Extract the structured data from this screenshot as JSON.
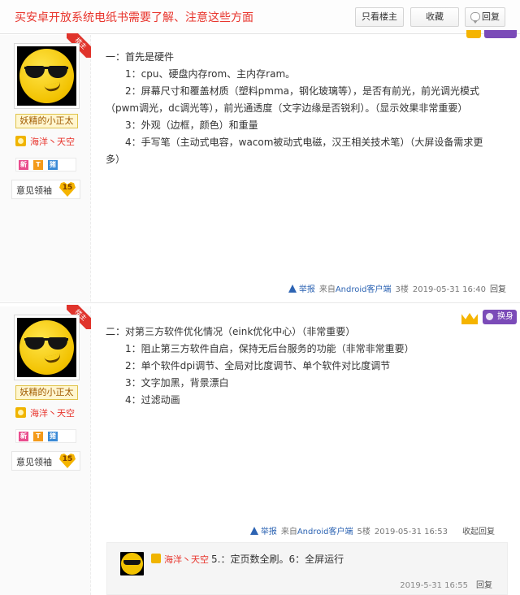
{
  "header": {
    "title": "买安卓开放系统电纸书需要了解、注意这些方面",
    "only_owner": "只看楼主",
    "favorite": "收藏",
    "reply": "回复"
  },
  "posts": [
    {
      "username": "妖精的小正太",
      "group": "海洋丶天空",
      "owner_tag": "楼主",
      "badges": [
        "新",
        "T",
        "猪"
      ],
      "level_label": "意见领袖",
      "level": "15",
      "lines": [
        "一：首先是硬件",
        "1：cpu、硬盘内存rom、主内存ram。",
        "2：屏幕尺寸和覆盖材质（塑料pmma，钢化玻璃等），是否有前光，前光调光模式（pwm调光，dc调光等），前光通透度（文字边缘是否锐利）。（显示效果非常重要）",
        "3：外观（边框，颜色）和重量",
        "4：手写笔（主动式电容，wacom被动式电磁，汉王相关技术笔）（大屏设备需求更多）"
      ],
      "footer": {
        "report": "举报",
        "from": "来自",
        "client": "Android客户端",
        "floor": "3楼",
        "time": "2019-05-31 16:40",
        "reply": "回复"
      }
    },
    {
      "username": "妖精的小正太",
      "group": "海洋丶天空",
      "owner_tag": "楼主",
      "badges": [
        "新",
        "T",
        "猪"
      ],
      "level_label": "意见领袖",
      "level": "15",
      "swap_label": "换身",
      "lines": [
        "二：对第三方软件优化情况（eink优化中心）（非常重要）",
        "1：阻止第三方软件自启，保持无后台服务的功能（非常非常重要）",
        "2：单个软件dpi调节、全局对比度调节、单个软件对比度调节",
        "3：文字加黑，背景漂白",
        "4：过滤动画"
      ],
      "footer": {
        "report": "举报",
        "from": "来自",
        "client": "Android客户端",
        "floor": "5楼",
        "time": "2019-05-31 16:53",
        "reply": "收起回复"
      },
      "subreply": {
        "user": "海洋丶天空",
        "text": "5.：定页数全刷。6：全屏运行",
        "time": "2019-5-31 16:55",
        "reply": "回复"
      }
    }
  ],
  "colors": {
    "title_red": "#e8352d",
    "link_blue": "#2d64b3",
    "vip_purple": "#7b4bb8",
    "gold": "#f5b400"
  }
}
